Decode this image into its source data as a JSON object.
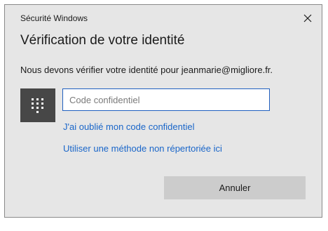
{
  "window": {
    "app_title": "Sécurité Windows"
  },
  "dialog": {
    "heading": "Vérification de votre identité",
    "message": "Nous devons vérifier votre identité pour jeanmarie@migliore.fr."
  },
  "pin": {
    "icon": "keypad-icon",
    "value": "",
    "placeholder": "Code confidentiel"
  },
  "links": {
    "forgot_pin": "J'ai oublié mon code confidentiel",
    "other_method": "Utiliser une méthode non répertoriée ici"
  },
  "buttons": {
    "cancel": "Annuler"
  },
  "colors": {
    "dialog_background": "#e6e6e6",
    "accent": "#1a66c9",
    "tile": "#474747",
    "button": "#cccccc"
  }
}
